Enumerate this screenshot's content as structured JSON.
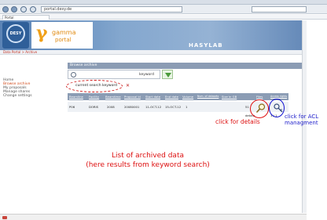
{
  "browser": {
    "tab_label": "Portal",
    "url": "portal.desy.de"
  },
  "banner": {
    "desy_label": "DESY",
    "gamma_symbol": "γ",
    "portal_line1": "gamma",
    "portal_line2": "portal",
    "hasylab_label": "HASYLAB"
  },
  "breadcrumb": "Data Portal > Archive",
  "leftnav": {
    "items": [
      {
        "label": "Home"
      },
      {
        "label": "Browse archive"
      },
      {
        "label": "My proposals"
      },
      {
        "label": "Manage shares"
      },
      {
        "label": "Change settings"
      }
    ]
  },
  "panel": {
    "title": "Browse archive"
  },
  "search": {
    "value": "keyword"
  },
  "filter": {
    "label": "current search keyword"
  },
  "table": {
    "headers": [
      "Beamline",
      "Facility",
      "Beamtime",
      "Proposal id",
      "Start date",
      "End date",
      "Volume",
      "Num. of datasets",
      "Size in GB",
      "Files",
      "Access rights"
    ],
    "rows": [
      {
        "cells": [
          "P06",
          "DORIS",
          "2008",
          "20080001",
          "11-OCT-12",
          "15-OCT-12",
          "1",
          "",
          "51"
        ]
      }
    ],
    "row2_cells": [
      "details",
      "1 / 1"
    ]
  },
  "annotations": {
    "details": "click for details",
    "acl_line1": "click for ACL",
    "acl_line2": "managment",
    "list_line1": "List of archived data",
    "list_line2": "(here results from keyword search)"
  },
  "colors": {
    "annotation_red": "#dd1111",
    "annotation_blue": "#2222cc",
    "header_bg": "#8b9cb4"
  },
  "icons": {
    "files": "magnifier-icon",
    "acl": "key-icon"
  }
}
